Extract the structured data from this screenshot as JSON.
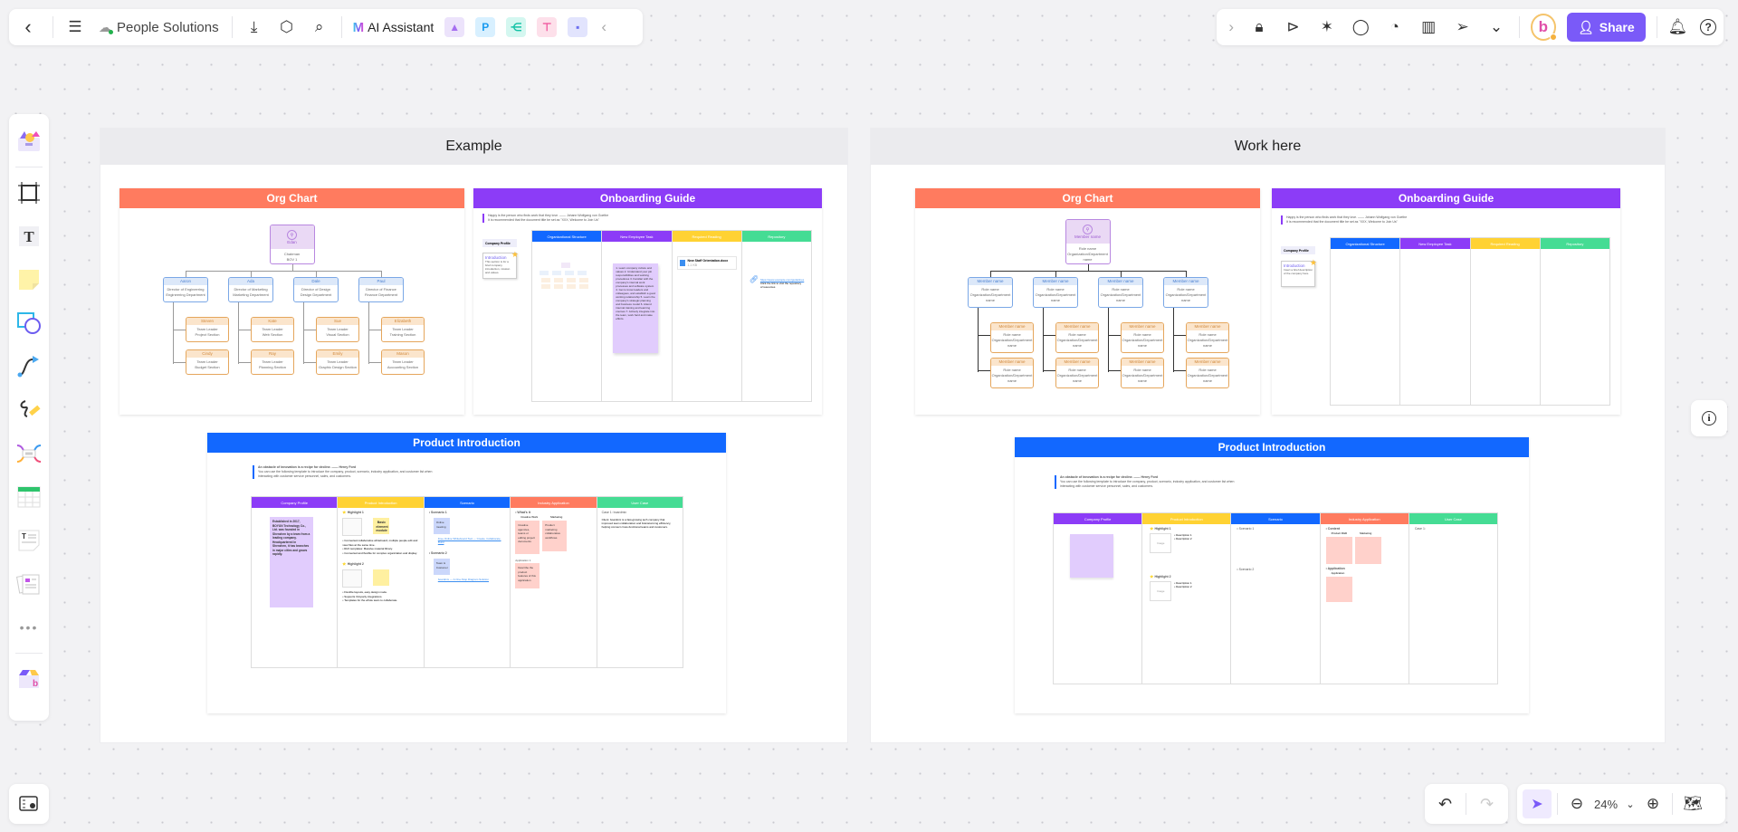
{
  "header": {
    "doc_title": "People Solutions",
    "ai_assistant_label": "AI Assistant",
    "share_label": "Share",
    "apps": [
      {
        "name": "image-app",
        "glyph": "▲",
        "bg": "#ece3fb",
        "fg": "#a66ff0"
      },
      {
        "name": "p-app",
        "glyph": "P",
        "bg": "#d8f0ff",
        "fg": "#1a9bf0"
      },
      {
        "name": "mindmap-app",
        "glyph": "⋲",
        "bg": "#d4f7f0",
        "fg": "#14c2a6"
      },
      {
        "name": "flow-app",
        "glyph": "⊤",
        "bg": "#fde0ea",
        "fg": "#f0509a"
      },
      {
        "name": "chat-app",
        "glyph": "▪",
        "bg": "#e2e4fd",
        "fg": "#6c6ff0"
      }
    ]
  },
  "zoom": {
    "level": "24%"
  },
  "frames": {
    "example": {
      "title": "Example",
      "org": {
        "title": "Org Chart",
        "root": {
          "name": "Edan",
          "role": "Chairman",
          "dept": "BOV 1"
        },
        "directors": [
          {
            "name": "Aaron",
            "role": "Director of Engineering",
            "dept": "Engineering Department"
          },
          {
            "name": "Ada",
            "role": "Director of Marketing",
            "dept": "Marketing Department"
          },
          {
            "name": "Dale",
            "role": "Director of Design",
            "dept": "Design Department"
          },
          {
            "name": "Paul",
            "role": "Director of Finance",
            "dept": "Finance Department"
          }
        ],
        "leads": [
          [
            {
              "name": "Steven",
              "role": "Team Leader",
              "dept": "Project Section"
            },
            {
              "name": "Cindy",
              "role": "Team Leader",
              "dept": "Budget Section"
            }
          ],
          [
            {
              "name": "Kate",
              "role": "Team Leader",
              "dept": "Web Section"
            },
            {
              "name": "Ray",
              "role": "Team Leader",
              "dept": "Planning Section"
            }
          ],
          [
            {
              "name": "Sue",
              "role": "Team Leader",
              "dept": "Visual Section"
            },
            {
              "name": "Emily",
              "role": "Team Leader",
              "dept": "Graphic Design Section"
            }
          ],
          [
            {
              "name": "Elizabeth",
              "role": "Team Leader",
              "dept": "Training Section"
            },
            {
              "name": "Mason",
              "role": "Team Leader",
              "dept": "Accounting Section"
            }
          ]
        ]
      },
      "onboarding": {
        "title": "Onboarding Guide",
        "quote": "Happy is the person who finds work that they love. —— Johann Wolfgang von Goethe",
        "note": "It is recommended that the document title be set as \"XXX, Welcome to Join Us\"",
        "profile_tag": "Company Profile",
        "intro_title": "Introduction",
        "intro_text": "This section is for a brief company introduction, mission and values.",
        "columns": [
          "Organizational Structure",
          "New Employee Task",
          "Required Reading",
          "Repository"
        ],
        "tasks": "1. Learn company culture and values 2. Understand your job responsibilities and working procedures 3. Familiar with the company's internal work processes and software system 4. Get to know leaders and colleagues, and establish a good working relationship 5. Learn the company's strategic planning and business model 6. Attend internal training and learning courses 7. Actively integrate into the team, work hard and make efforts.",
        "file_name": "New Staff Orientation.docx",
        "file_size": "1.1 KB",
        "link_text": "https://www.example.com/guidelines",
        "link_desc": "Click the link to visit the repository of resources"
      },
      "product": {
        "title": "Product Introduction",
        "quote": "An obstacle of innovation is a recipe for decline. —— Henry Ford",
        "note": "You can use the following template to introduce the company, product, scenario, industry application, and customer list when interacting with customer service personnel, sales, and customers.",
        "columns": [
          "Company Profile",
          "Product Introduction",
          "Scenario",
          "Industry Application",
          "User Case"
        ],
        "profile_text": "Established in 2017, BOYUN Technology Co., Ltd. was founded in Shenzhen by a team from a leading company. Headquartered in Shenzhen, it has branches in major cities and grows rapidly.",
        "highlights": [
          "Highlight 1",
          "Highlight 2"
        ],
        "highlight_note": "Basic element module",
        "bullets": [
          "Connected collaborative whiteboard, multiple people edit and view files at the same time.",
          "Rich templates: Massive material library.",
          "Connected and flexible for complex organization and display.",
          "Flexible layouts, easy design mode.",
          "Supports 3rd-party integrations.",
          "Templates for the whole team to collaborate."
        ],
        "scenarios": [
          {
            "label": "Scenario 1",
            "sticky": "Online meeting",
            "link": "Free Online Whiteboard Tool — Create, Collaborate, Build"
          },
          {
            "label": "Scenario 2",
            "sticky": "Team & Customer",
            "link": "boardmix — A One-Stop Diagram Solution"
          }
        ],
        "industry": {
          "head": "What's it",
          "tags": [
            "Creative Work",
            "Marketing"
          ],
          "app": "Application 1",
          "stickies": [
            "Creative agencies, teams or editing project documents",
            "Product marketing collaborative workflows",
            "Describe the product features of this application"
          ]
        },
        "user_case": {
          "title": "Case 1: boardmix",
          "text": "Client: boardmix is a fast-growing tech company that improved team collaboration and brainstorming efficiency, helping connect cross-functional teams and customers."
        }
      }
    },
    "work": {
      "title": "Work here",
      "org": {
        "title": "Org Chart",
        "placeholder_name": "Member name",
        "placeholder_role": "Role name",
        "placeholder_dept": "Organization/Department name"
      },
      "onboarding": {
        "title": "Onboarding Guide",
        "quote": "Happy is the person who finds work that they love. —— Johann Wolfgang von Goethe",
        "note": "It is recommended that the document title be set as \"XXX, Welcome to Join Us\"",
        "profile_tag": "Company Profile",
        "intro_title": "Introduction",
        "intro_text": "Insert a brief description of the company here.",
        "columns": [
          "Organizational Structure",
          "New Employee Task",
          "Required Reading",
          "Repository"
        ]
      },
      "product": {
        "title": "Product Introduction",
        "quote": "An obstacle of innovation is a recipe for decline. —— Henry Ford",
        "note": "You can use the following template to introduce the company, product, scenario, industry application, and customer list when interacting with customer service personnel, sales, and customers.",
        "columns": [
          "Company Profile",
          "Product Introduction",
          "Scenario",
          "Industry Application",
          "User Case"
        ],
        "highlights": [
          "Highlight 1",
          "Highlight 2"
        ],
        "image_label": "Image",
        "descriptions": [
          "Description 1",
          "Description 2"
        ],
        "scenarios": [
          "Scenario 1",
          "Scenario 2"
        ],
        "industry_heads": [
          "Content",
          "Application"
        ],
        "industry_tags": [
          "Product R&D",
          "Marketing"
        ],
        "industry_app_tag": "Application",
        "user_case": "Case 1:"
      }
    }
  },
  "colors": {
    "org": "#ff7b5f",
    "onboarding": "#8c3cf7",
    "product": "#1268ff",
    "blue": "#1268ff",
    "purple": "#8c3cf7",
    "yellow": "#ffd233",
    "green": "#45dc94",
    "salmon": "#ff7b5f",
    "accent": "#7a5af8"
  }
}
